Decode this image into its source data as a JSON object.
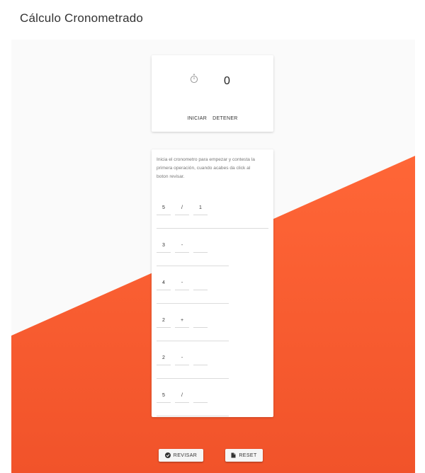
{
  "page": {
    "title": "Cálculo Cronometrado"
  },
  "timer": {
    "icon": "stopwatch-icon",
    "value": "0",
    "start_label": "INICIAR",
    "stop_label": "DETENER"
  },
  "instructions": "Inicia el cronometro para empezar y contesta la primera operación, cuando acabes da click al boton revisar.",
  "operations": [
    {
      "a": "5",
      "op": "/",
      "b": "1"
    },
    {
      "a": "3",
      "op": "-",
      "b": ""
    },
    {
      "a": "4",
      "op": "-",
      "b": ""
    },
    {
      "a": "2",
      "op": "+",
      "b": ""
    },
    {
      "a": "2",
      "op": "-",
      "b": ""
    },
    {
      "a": "5",
      "op": "/",
      "b": ""
    }
  ],
  "actions": {
    "review_label": "REVISAR",
    "review_icon": "check-circle-icon",
    "reset_label": "RESET",
    "reset_icon": "document-icon"
  },
  "colors": {
    "accent_top": "#ff6637",
    "accent_bottom": "#f1532a",
    "background": "#fafafa"
  }
}
